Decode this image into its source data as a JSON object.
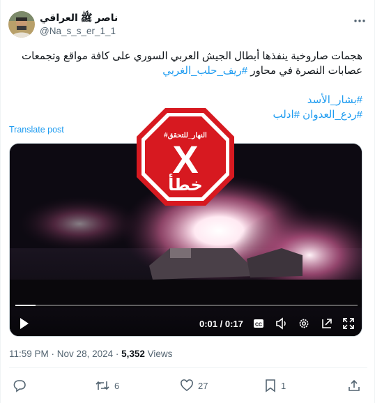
{
  "author": {
    "display_name": "ناصر ﷺ العراقي",
    "handle": "@Na_s_s_er_1_1"
  },
  "tweet": {
    "line1": "هجمات صاروخية ينفذها أبطال الجيش العربي السوري على كافة مواقع وتجمعات",
    "line2_text": "عصابات النصرة في محاور ",
    "line2_tag": "#ريف_حلب_الغربي",
    "tags_line3": "#بشار_الأسد",
    "tags_line4a": "#ردع_العدوان",
    "tags_line4b": "#ادلب",
    "translate_label": "Translate post"
  },
  "video": {
    "current_time": "0:01",
    "separator": " / ",
    "duration": "0:17",
    "progress_fraction": 0.06
  },
  "stamp": {
    "brand": "#النهار_للتحقق",
    "verdict": "خطأ",
    "mark": "X",
    "color": "#d71920"
  },
  "meta": {
    "time": "11:59 PM",
    "dot": " · ",
    "date": "Nov 28, 2024",
    "dot2": " · ",
    "views_count": "5,352",
    "views_label": " Views"
  },
  "actions": {
    "reply_count": "",
    "retweet_count": "6",
    "like_count": "27",
    "bookmark_count": "1"
  },
  "colors": {
    "accent": "#1d9bf0",
    "muted": "#536471"
  }
}
